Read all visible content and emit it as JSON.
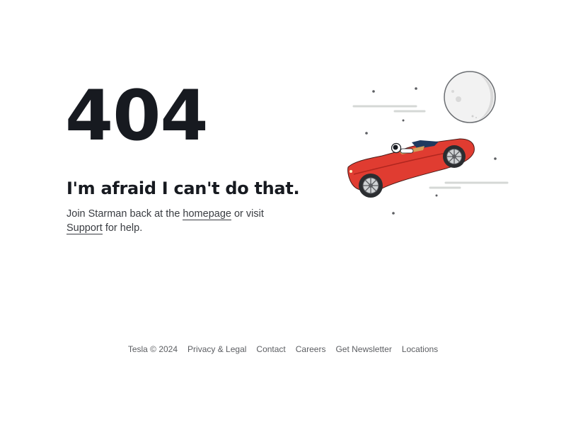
{
  "error": {
    "code": "404",
    "headline": "I'm afraid I can't do that.",
    "message_part1": "Join Starman back at the ",
    "homepage_link": "homepage",
    "message_part2": " or visit ",
    "support_link": "Support",
    "message_part3": " for help."
  },
  "illustration": {
    "icon": "starman-roadster-moon-illustration",
    "car_color": "#e03c31",
    "moon_color": "#f2f2f2"
  },
  "footer": {
    "copyright": "Tesla © 2024",
    "links": [
      "Privacy & Legal",
      "Contact",
      "Careers",
      "Get Newsletter",
      "Locations"
    ]
  }
}
